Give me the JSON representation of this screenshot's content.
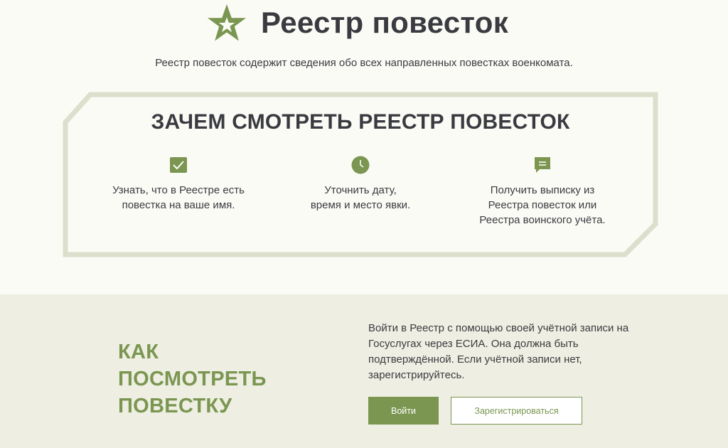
{
  "header": {
    "logo_icon": "army-star-icon",
    "title": "Реестр повесток"
  },
  "intro": "Реестр повесток содержит сведения обо всех направленных повестках военкомата.",
  "why": {
    "title": "ЗАЧЕМ СМОТРЕТЬ РЕЕСТР ПОВЕСТОК",
    "features": [
      {
        "icon": "envelope-check-icon",
        "text": "Узнать, что в Реестре есть\nповестка на ваше имя."
      },
      {
        "icon": "clock-icon",
        "text": "Уточнить дату,\nвремя и место явки."
      },
      {
        "icon": "document-message-icon",
        "text": "Получить выписку из\nРеестра повесток или\nРеестра воинского учёта."
      }
    ]
  },
  "how": {
    "title": "КАК\nПОСМОТРЕТЬ\nПОВЕСТКУ",
    "text": "Войти в Реестр с помощью своей учётной записи на Госуслугах через ЕСИА. Она должна быть подтверждённой. Если учётной записи нет, зарегистрируйтесь.",
    "login_label": "Войти",
    "register_label": "Зарегистрироваться"
  },
  "colors": {
    "accent": "#7a9651",
    "text": "#3a3b40",
    "frame": "#dcdfcb",
    "bottom_bg": "#eeeee2",
    "page_bg": "#fbfbf6"
  }
}
